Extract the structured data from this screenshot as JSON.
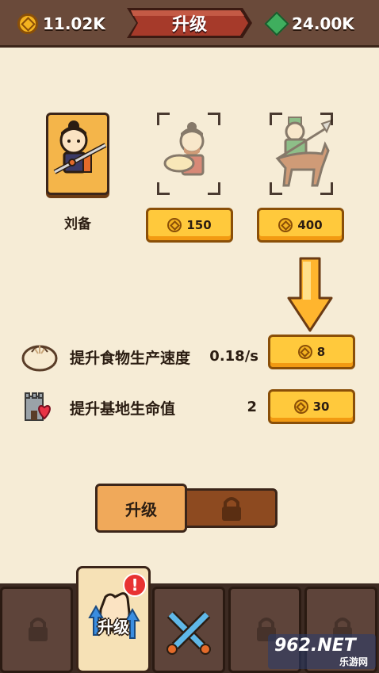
{
  "header": {
    "title": "升级",
    "gold_amount": "11.02K",
    "gem_amount": "24.00K",
    "colors": {
      "bar": "#6a4a3a",
      "banner": "#a63a2a"
    }
  },
  "heroes": [
    {
      "name": "刘备",
      "owned": true
    },
    {
      "cost": "150",
      "owned": false
    },
    {
      "cost": "400",
      "owned": false
    }
  ],
  "upgrades": [
    {
      "label": "提升食物生产速度",
      "value": "0.18/s",
      "cost": "8",
      "icon": "steamed-bun-icon"
    },
    {
      "label": "提升基地生命值",
      "value": "2",
      "cost": "30",
      "icon": "castle-heart-icon"
    }
  ],
  "tabs": {
    "upgrade_label": "升级",
    "locked_icon": "lock-icon"
  },
  "bottom_nav": {
    "active_label": "升级",
    "badge": "!",
    "items": [
      "lock-icon",
      "fist-upgrade-icon",
      "crossed-swords-icon",
      "lock-icon",
      "lock-icon"
    ]
  },
  "watermark": {
    "main": "962.NET",
    "sub": "乐游网"
  }
}
